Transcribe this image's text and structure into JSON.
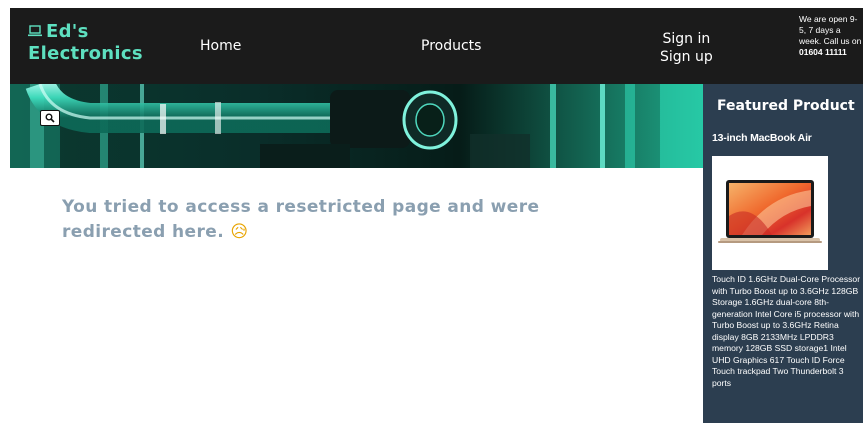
{
  "header": {
    "brand_line1": "Ed's",
    "brand_line2": "Electronics",
    "nav": {
      "home": "Home",
      "products": "Products",
      "sign_in": "Sign in",
      "sign_up": "Sign up"
    },
    "opening_text": "We are open 9-5, 7 days a week. Call us on",
    "phone": "01604 11111"
  },
  "main": {
    "message": "You tried to access a resetricted page and were redirected here.",
    "emoji": "😥"
  },
  "sidebar": {
    "title": "Featured Product",
    "product_name": "13-inch MacBook Air",
    "product_description": "Touch ID 1.6GHz Dual-Core Processor with Turbo Boost up to 3.6GHz 128GB Storage 1.6GHz dual-core 8th-generation Intel Core i5 processor with Turbo Boost up to 3.6GHz Retina display 8GB 2133MHz LPDDR3 memory 128GB SSD storage1 Intel UHD Graphics 617 Touch ID Force Touch trackpad Two Thunderbolt 3 ports"
  },
  "icons": {
    "logo": "laptop-icon",
    "search": "search-icon"
  },
  "colors": {
    "navbar_bg": "#1b1b1b",
    "brand": "#5ee0c0",
    "message": "#8a9fb0",
    "sidebar_bg": "#2c3e50"
  }
}
